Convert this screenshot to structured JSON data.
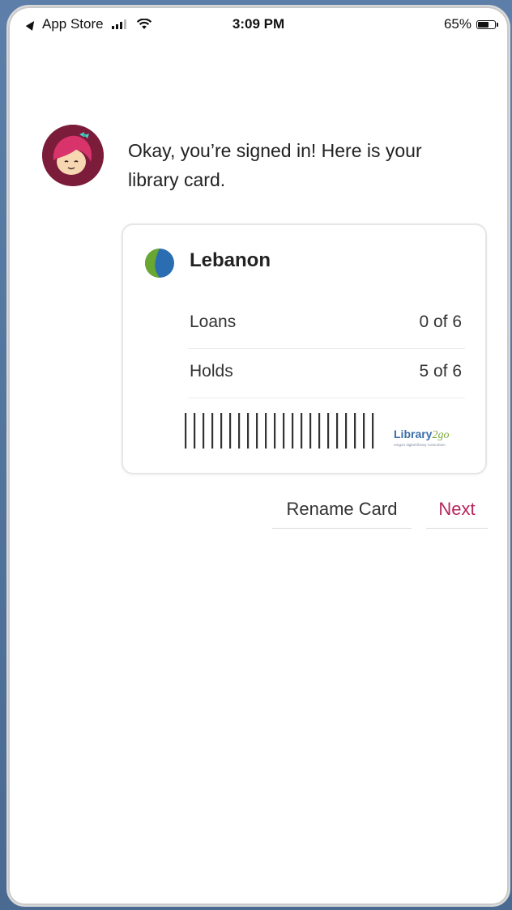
{
  "status_bar": {
    "back_app": "App Store",
    "time": "3:09 PM",
    "battery": "65%"
  },
  "message": {
    "text": "Okay, you’re signed in! Here is your library card."
  },
  "card": {
    "library_name": "Lebanon",
    "rows": [
      {
        "label": "Loans",
        "value": "0 of 6"
      },
      {
        "label": "Holds",
        "value": "5 of 6"
      }
    ],
    "brand_logo_text": "Library2go",
    "brand_tagline": "oregon digital library consortium"
  },
  "actions": {
    "rename_label": "Rename Card",
    "next_label": "Next"
  },
  "colors": {
    "accent": "#b8245b",
    "avatar_bg": "#7c1c3b"
  }
}
